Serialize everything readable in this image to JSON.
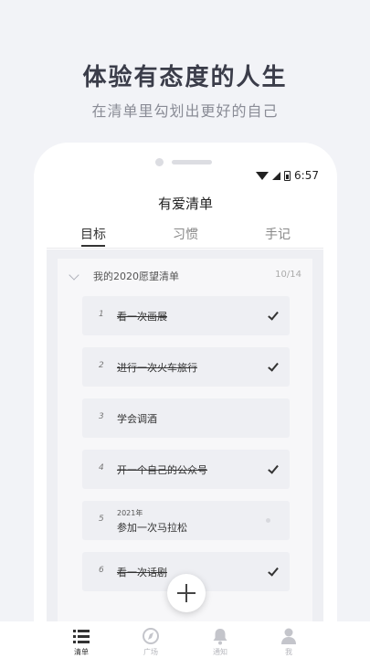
{
  "promo": {
    "headline": "体验有态度的人生",
    "subline": "在清单里勾划出更好的自己"
  },
  "status": {
    "time": "6:57"
  },
  "app": {
    "title": "有爱清单"
  },
  "tabs": [
    {
      "label": "目标",
      "active": true
    },
    {
      "label": "习惯",
      "active": false
    },
    {
      "label": "手记",
      "active": false
    }
  ],
  "group": {
    "title": "我的2020愿望清单",
    "count": "10/14"
  },
  "items": [
    {
      "num": "1",
      "text": "看一次画展",
      "done": true
    },
    {
      "num": "2",
      "text": "进行一次火车旅行",
      "done": true
    },
    {
      "num": "3",
      "text": "学会调酒",
      "done": false
    },
    {
      "num": "4",
      "text": "开一个自己的公众号",
      "done": true
    },
    {
      "num": "5",
      "year": "2021年",
      "text": "参加一次马拉松",
      "done": false
    },
    {
      "num": "6",
      "text": "看一次话剧",
      "done": true
    }
  ],
  "nav": [
    {
      "label": "清单",
      "icon": "list-icon",
      "active": true
    },
    {
      "label": "广场",
      "icon": "compass-icon",
      "active": false
    },
    {
      "label": "通知",
      "icon": "bell-icon",
      "active": false
    },
    {
      "label": "我",
      "icon": "person-icon",
      "active": false
    }
  ]
}
